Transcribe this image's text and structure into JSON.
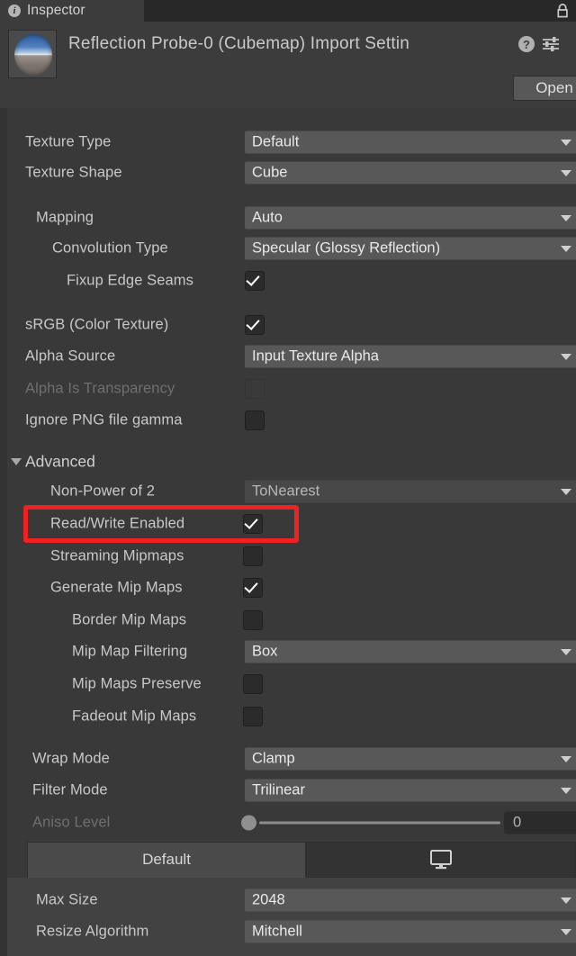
{
  "window": {
    "tab_label": "Inspector",
    "info_icon": "info-icon",
    "lock_icon": "lock-icon"
  },
  "object_header": {
    "title": "Reflection Probe-0 (Cubemap) Import Settin",
    "thumbnail_icon": "cubemap-preview-thumbnail",
    "help_icon": "help-icon",
    "help_glyph": "?",
    "preset_icon": "preset-settings-icon",
    "open_button": "Open"
  },
  "properties": [
    {
      "label": "Texture Type",
      "control": "dropdown",
      "value": "Default",
      "indent": 28,
      "dim": false,
      "disabled": false
    },
    {
      "label": "Texture Shape",
      "control": "dropdown",
      "value": "Cube",
      "indent": 28,
      "dim": false,
      "disabled": false
    },
    {
      "label": "Mapping",
      "control": "dropdown",
      "value": "Auto",
      "indent": 40,
      "dim": false,
      "disabled": false
    },
    {
      "label": "Convolution Type",
      "control": "dropdown",
      "value": "Specular (Glossy Reflection)",
      "indent": 58,
      "dim": false,
      "disabled": false
    },
    {
      "label": "Fixup Edge Seams",
      "control": "checkbox",
      "checked": true,
      "indent": 74,
      "dim": false
    },
    {
      "label": "sRGB (Color Texture)",
      "control": "checkbox",
      "checked": true,
      "indent": 28,
      "dim": false
    },
    {
      "label": "Alpha Source",
      "control": "dropdown",
      "value": "Input Texture Alpha",
      "indent": 28,
      "dim": false,
      "disabled": false
    },
    {
      "label": "Alpha Is Transparency",
      "control": "checkbox",
      "checked": false,
      "indent": 28,
      "dim": true
    },
    {
      "label": "Ignore PNG file gamma",
      "control": "checkbox",
      "checked": false,
      "indent": 28,
      "dim": false
    }
  ],
  "advanced_section": {
    "label": "Advanced",
    "expanded": true,
    "arrow_icon": "triangle-down-icon",
    "properties": [
      {
        "label": "Non-Power of 2",
        "control": "dropdown",
        "value": "ToNearest",
        "indent": 56,
        "dim": false,
        "disabled": true
      },
      {
        "label": "Read/Write Enabled",
        "control": "checkbox",
        "checked": true,
        "indent": 56,
        "dim": false
      },
      {
        "label": "Streaming Mipmaps",
        "control": "checkbox",
        "checked": false,
        "indent": 56,
        "dim": false
      },
      {
        "label": "Generate Mip Maps",
        "control": "checkbox",
        "checked": true,
        "indent": 56,
        "dim": false
      },
      {
        "label": "Border Mip Maps",
        "control": "checkbox",
        "checked": false,
        "indent": 80,
        "dim": false
      },
      {
        "label": "Mip Map Filtering",
        "control": "dropdown",
        "value": "Box",
        "indent": 80,
        "dim": false,
        "disabled": false
      },
      {
        "label": "Mip Maps Preserve",
        "control": "checkbox",
        "checked": false,
        "indent": 80,
        "dim": false
      },
      {
        "label": "Fadeout Mip Maps",
        "control": "checkbox",
        "checked": false,
        "indent": 80,
        "dim": false
      }
    ]
  },
  "sampling": [
    {
      "label": "Wrap Mode",
      "control": "dropdown",
      "value": "Clamp",
      "indent": 36,
      "dim": false,
      "disabled": false
    },
    {
      "label": "Filter Mode",
      "control": "dropdown",
      "value": "Trilinear",
      "indent": 36,
      "dim": false,
      "disabled": false
    }
  ],
  "aniso": {
    "label": "Aniso Level",
    "value": "0",
    "slider_min": 0,
    "slider_max": 16,
    "slider_position_pct": 0,
    "dim": true
  },
  "platform_tabs": {
    "selected": "Default",
    "tabs": [
      {
        "label": "Default",
        "icon": "",
        "selected": true
      },
      {
        "label": "",
        "icon": "monitor-icon",
        "selected": false
      }
    ]
  },
  "platform_properties": [
    {
      "label": "Max Size",
      "control": "dropdown",
      "value": "2048",
      "indent": 40
    },
    {
      "label": "Resize Algorithm",
      "control": "dropdown",
      "value": "Mitchell",
      "indent": 40
    }
  ],
  "highlight": {
    "target": "Read/Write Enabled",
    "color": "#ee2222"
  },
  "colors": {
    "panel_bg": "#393939",
    "header_bg": "#3c3c3c",
    "tabbar_bg": "#282828",
    "dropdown_bg": "#585858",
    "dropdown_disabled_bg": "#484848",
    "checkbox_bg": "#2b2b2b",
    "text": "#c8c8c8",
    "text_dim": "#6f6f6f",
    "highlight_red": "#ee2222"
  }
}
